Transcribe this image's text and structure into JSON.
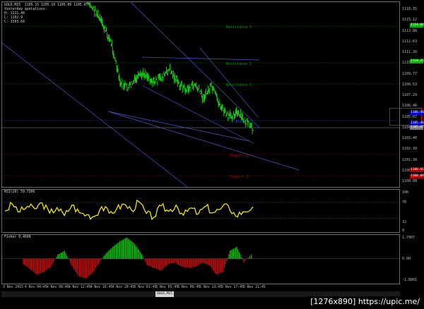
{
  "window": {
    "symbol_title": "GOLD,M15  1105.15 1105.19 1105.06 1105.07",
    "yesterday_lines": [
      "Yesterday quotations:",
      "H: 1111.40",
      "L: 1102.9",
      "C: 1103.69"
    ]
  },
  "price_pane": {
    "axis_ticks": [
      "1116.35",
      "1115.12",
      "1113.88",
      "1112.63",
      "1111.38",
      "1110.58",
      "1109.77",
      "1108.53",
      "1107.29",
      "1106.46",
      "1105.07",
      "1104.80",
      "1103.40",
      "1102.39",
      "1101.30",
      "1100.91",
      "1100.08"
    ],
    "price_tags": [
      {
        "label": "1114.04",
        "color": "#00b400"
      },
      {
        "label": "1110.35",
        "color": "#00b400"
      },
      {
        "label": "1106.46",
        "color": "#0000d0"
      },
      {
        "label": "1105.46",
        "color": "#0000d0"
      },
      {
        "label": "1105.07",
        "color": "#7a7a7a"
      },
      {
        "label": "1100.91",
        "color": "#b00000"
      },
      {
        "label": "1100.08",
        "color": "#b00000"
      }
    ],
    "levels": [
      {
        "label": "Resistance 3",
        "color": "#00a000"
      },
      {
        "label": "Resistance 2",
        "color": "#00a000"
      },
      {
        "label": "Resistance 1",
        "color": "#00a000"
      },
      {
        "label": "Pivot",
        "color": "#3050ff"
      },
      {
        "label": "Support 1",
        "color": "#c00000"
      },
      {
        "label": "Support 2",
        "color": "#c00000"
      }
    ]
  },
  "rsi_pane": {
    "title": "RSI(20) 59.7306",
    "axis_ticks": [
      "100",
      "70",
      "32",
      "0"
    ]
  },
  "fisher_pane": {
    "title": "Fisher 0.4609",
    "axis_ticks": [
      "1.7907",
      "0.00",
      "-1.8801"
    ]
  },
  "time_axis": [
    "3 Nov 2015",
    "4 Nov 04:45",
    "4 Nov 08:45",
    "4 Nov 12:45",
    "4 Nov 16:45",
    "4 Nov 20:45",
    "5 Nov 01:45",
    "5 Nov 05:45",
    "5 Nov 09:45",
    "5 Nov 13:45",
    "5 Nov 17:45",
    "5 Nov 21:45"
  ],
  "tabs": {
    "active": "GOLD,M15"
  },
  "watermark": "[1276x890] https://upic.me/",
  "chart_data": [
    {
      "type": "line",
      "name": "price",
      "x": [
        0,
        5,
        10,
        15,
        20,
        25,
        30,
        35,
        40,
        45,
        50,
        55,
        60,
        65,
        70,
        75,
        80,
        85,
        90,
        95,
        100
      ],
      "y": [
        1116.4,
        1115.6,
        1114.2,
        1112.6,
        1109.2,
        1108.8,
        1109.6,
        1110.1,
        1109.3,
        1109.7,
        1110.4,
        1109.2,
        1108.6,
        1109.1,
        1108.0,
        1108.9,
        1107.3,
        1106.2,
        1106.6,
        1105.9,
        1105.07
      ],
      "ylim": [
        1100.08,
        1116.35
      ]
    },
    {
      "type": "line",
      "name": "RSI(20)",
      "x": [
        0,
        3,
        6,
        9,
        12,
        15,
        18,
        21,
        24,
        27,
        30,
        33,
        36,
        39,
        42,
        45,
        48,
        51,
        54,
        57,
        60,
        63,
        66,
        69,
        72,
        75,
        78,
        81,
        84,
        87,
        90,
        93,
        96,
        100
      ],
      "y": [
        50,
        66,
        48,
        61,
        55,
        69,
        45,
        58,
        39,
        64,
        46,
        41,
        37,
        60,
        45,
        55,
        66,
        52,
        72,
        44,
        35,
        62,
        49,
        64,
        40,
        57,
        43,
        61,
        46,
        55,
        63,
        38,
        48,
        59.73
      ],
      "ylim": [
        0,
        100
      ]
    },
    {
      "type": "bar",
      "name": "Fisher",
      "x": [
        0,
        3,
        6,
        9,
        12,
        15,
        18,
        21,
        24,
        27,
        30,
        33,
        36,
        39,
        42,
        45,
        48,
        51,
        54,
        57,
        60,
        63,
        66,
        69,
        72,
        75,
        78,
        81,
        84,
        87,
        90,
        93,
        96,
        100
      ],
      "values": [
        -0.4,
        -0.8,
        -1.2,
        -1.0,
        -0.6,
        0.3,
        0.6,
        -0.5,
        -1.3,
        -1.5,
        -1.1,
        -0.3,
        0.4,
        0.9,
        1.3,
        1.6,
        1.2,
        0.5,
        -0.5,
        -0.7,
        -0.9,
        -0.4,
        -0.3,
        -0.6,
        -0.7,
        -0.6,
        -0.3,
        -0.5,
        -1.2,
        -1.0,
        0.6,
        0.9,
        -0.3,
        0.4609
      ],
      "ylim": [
        -1.8801,
        1.7907
      ]
    }
  ]
}
